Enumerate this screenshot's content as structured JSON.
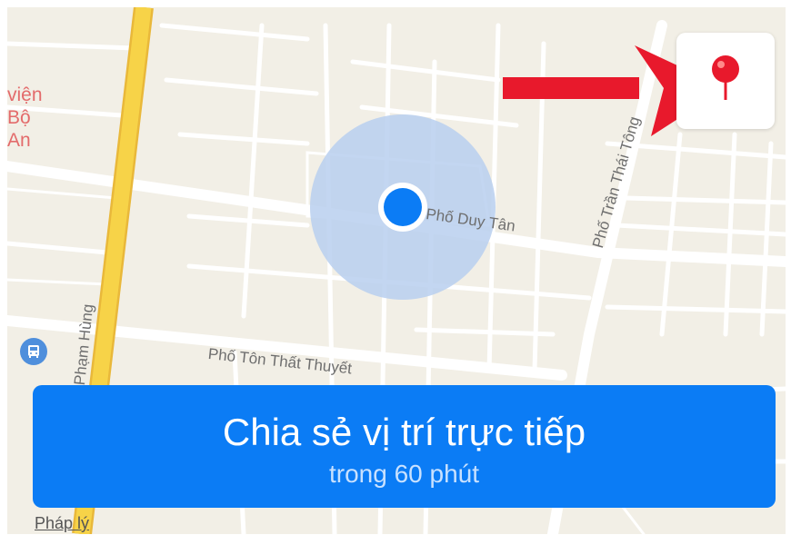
{
  "map": {
    "poi_label_lines": [
      "viện",
      "Bộ",
      "An"
    ],
    "streets": {
      "duy_tan": "Phố Duy Tân",
      "tran_thai_tong": "Phố Trần Thái Tông",
      "ton_that_thuyet": "Phố Tôn Thất Thuyết",
      "pham_hung": "Phạm Hùng"
    },
    "colors": {
      "background": "#f2efe6",
      "road": "#ffffff",
      "highway": "#f7d348",
      "location_dot": "#0b7cf5",
      "accuracy_halo": "#b9cfee"
    }
  },
  "controls": {
    "drop_pin_icon": "map-pin-icon",
    "pin_color": "#e8192c",
    "arrow_color": "#e8192c"
  },
  "share": {
    "title": "Chia sẻ vị trí trực tiếp",
    "subtitle": "trong 60 phút",
    "color": "#0b7cf5"
  },
  "footer": {
    "legal_link": "Pháp lý"
  }
}
